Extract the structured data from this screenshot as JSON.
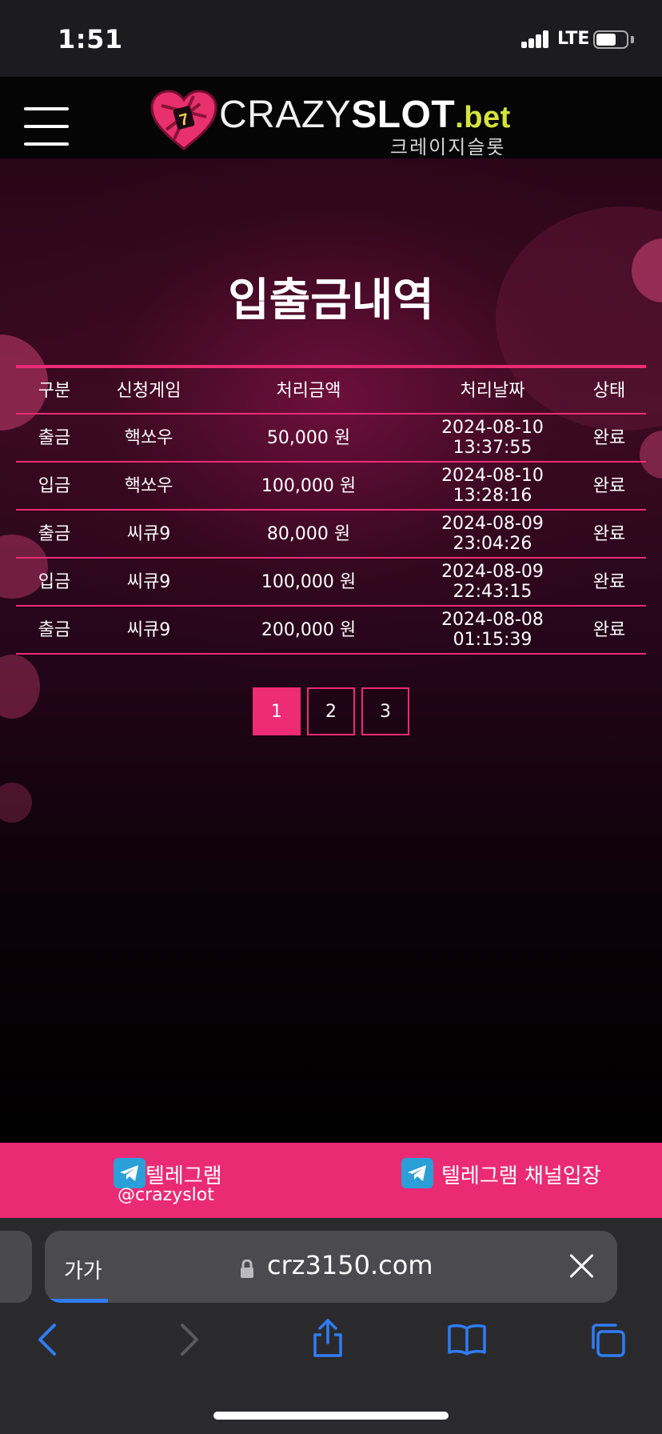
{
  "status_bar": {
    "time": "1:51",
    "network": "LTE"
  },
  "header": {
    "logo": {
      "part1": "CRAZY",
      "part2": "SLOT",
      "part3": ".bet",
      "subtitle": "크레이지슬롯"
    }
  },
  "page": {
    "title": "입출금내역"
  },
  "table": {
    "headers": [
      "구분",
      "신청게임",
      "처리금액",
      "처리날짜",
      "상태"
    ],
    "rows": [
      {
        "type": "출금",
        "game": "핵쏘우",
        "amount": "50,000 원",
        "date": "2024-08-10",
        "time": "13:37:55",
        "status": "완료"
      },
      {
        "type": "입금",
        "game": "핵쏘우",
        "amount": "100,000 원",
        "date": "2024-08-10",
        "time": "13:28:16",
        "status": "완료"
      },
      {
        "type": "출금",
        "game": "씨큐9",
        "amount": "80,000 원",
        "date": "2024-08-09",
        "time": "23:04:26",
        "status": "완료"
      },
      {
        "type": "입금",
        "game": "씨큐9",
        "amount": "100,000 원",
        "date": "2024-08-09",
        "time": "22:43:15",
        "status": "완료"
      },
      {
        "type": "출금",
        "game": "씨큐9",
        "amount": "200,000 원",
        "date": "2024-08-08",
        "time": "01:15:39",
        "status": "완료"
      }
    ]
  },
  "pagination": {
    "pages": [
      "1",
      "2",
      "3"
    ],
    "current": "1"
  },
  "telegram_bar": {
    "left_label": "텔레그램",
    "left_handle": "@crazyslot",
    "right_label": "텔레그램 채널입장"
  },
  "browser": {
    "text_size_button": "가가",
    "url": "crz3150.com",
    "load_progress": 0.11
  },
  "icons": {
    "menu": "hamburger-icon",
    "telegram": "telegram-icon",
    "lock": "lock-icon",
    "close": "close-icon",
    "back": "chevron-left-icon",
    "forward": "chevron-right-icon",
    "share": "share-icon",
    "bookmarks": "book-icon",
    "tabs": "tabs-icon"
  },
  "colors": {
    "accent": "#ee2b75",
    "telegram_bar": "#eb2a74",
    "logo_bet": "#d5e33a",
    "ios_blue": "#2f7cf6"
  }
}
